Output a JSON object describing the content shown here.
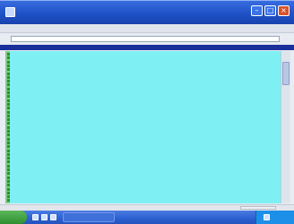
{
  "window": {
    "title": "",
    "controls": {
      "minimize": "–",
      "maximize": "□",
      "close": "×"
    }
  },
  "menubar": {
    "items": [
      "",
      "",
      "",
      "",
      ""
    ]
  },
  "toolbar": {
    "address": ""
  },
  "header": {
    "text": ""
  },
  "content": {
    "lines": [
      "",
      "",
      "",
      "",
      "",
      "",
      "",
      "",
      "",
      "",
      "",
      "",
      "",
      "",
      "",
      "",
      "",
      "",
      "",
      "",
      "",
      "",
      "",
      "",
      "",
      "",
      "",
      "",
      "",
      "",
      "",
      "",
      "",
      "",
      "",
      "",
      "",
      "",
      ""
    ]
  },
  "colors": {
    "titlebar": "#1f52c8",
    "content_bg": "#7ef0f4",
    "link_text": "#1a3da0",
    "bullet": "#2e8f2e",
    "taskbar": "#2c5fd0"
  },
  "icons": [
    "app-icon",
    "minimize-icon",
    "maximize-icon",
    "close-icon",
    "start-icon",
    "clock-icon"
  ]
}
